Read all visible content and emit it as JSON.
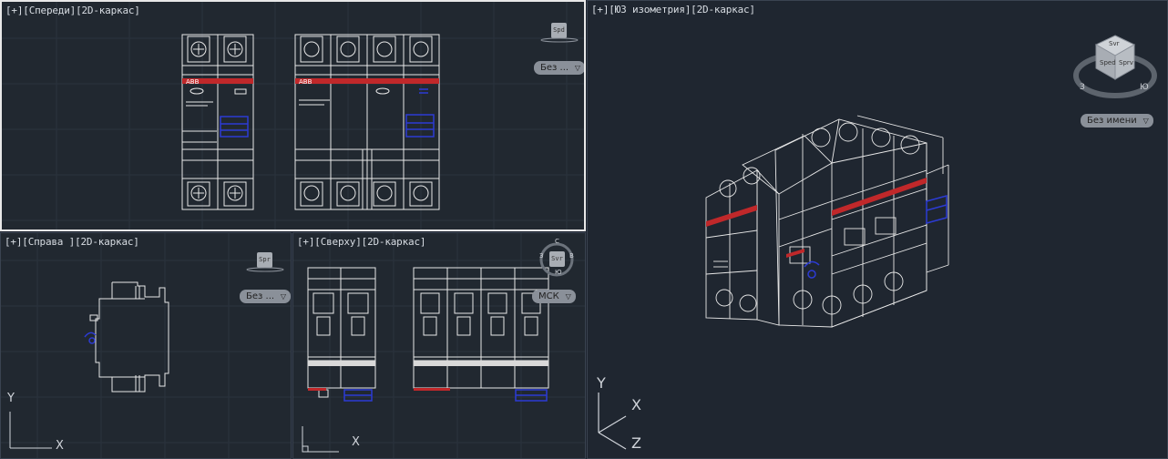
{
  "viewports": {
    "front": {
      "label": "[+][Спереди][2D-каркас]",
      "ucs_label": "Без ...",
      "viewcube_face": "Spd"
    },
    "right": {
      "label": "[+][Справа ][2D-каркас]",
      "ucs_label": "Без ...",
      "viewcube_face": "Spr"
    },
    "top": {
      "label": "[+][Сверху][2D-каркас]",
      "ucs_label": "МСК",
      "viewcube_face": "Svr",
      "compass": {
        "n": "С",
        "s": "Ю",
        "w": "З",
        "e": "В"
      }
    },
    "iso": {
      "label": "[+][ЮЗ изометрия][2D-каркас]",
      "ucs_label": "Без имени",
      "viewcube_faces": [
        "Svr",
        "Sped",
        "Sprv"
      ],
      "compass": {
        "s": "Ю",
        "w": "З"
      }
    }
  },
  "ucs_axes": {
    "x": "X",
    "y": "Y",
    "z": "Z"
  },
  "device_brand": "ABB",
  "colors": {
    "background": "#212830",
    "grid": "#2b333e",
    "linework": "#e8e8e8",
    "red_band": "#c0282a",
    "blue": "#2c3bd4",
    "active_border": "#e8e8e8"
  }
}
